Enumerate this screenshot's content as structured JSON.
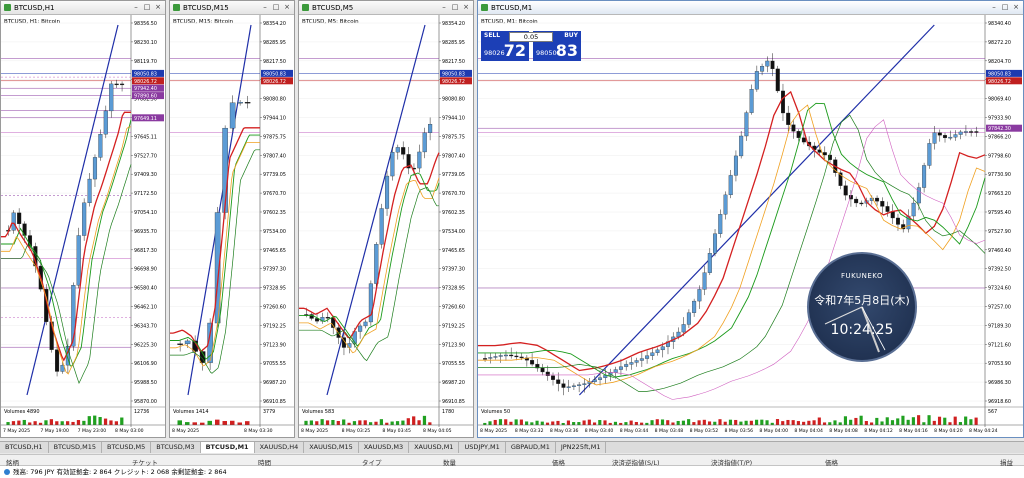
{
  "windows": [
    {
      "title": "BTCUSD,H1",
      "sub": "BTCUSD, H1: Bitcoin",
      "prices": [
        "98356.50",
        "98230.10",
        "98119.70",
        "97991.80",
        "97882.90",
        "97764.00",
        "97645.11",
        "97527.70",
        "97409.30",
        "97172.50",
        "97054.10",
        "96935.70",
        "96817.30",
        "96698.90",
        "96580.40",
        "96462.10",
        "96343.70",
        "96225.30",
        "96106.90",
        "95988.50",
        "95870.00"
      ],
      "labels": [
        "98050.83",
        "98026.72",
        "97942.40",
        "97890.60",
        "97649.11"
      ],
      "dates": [
        "7 May 2025",
        "7 May 19:00",
        "7 May 23:00",
        "8 May 03:00"
      ],
      "volume": "Volumes 4890",
      "vol_right": "12736"
    },
    {
      "title": "BTCUSD,M15",
      "sub": "BTCUSD, M15: Bitcoin",
      "prices": [
        "98354.20",
        "98285.95",
        "98217.50",
        "98149.15",
        "98080.80",
        "97944.10",
        "97875.75",
        "97807.40",
        "97739.05",
        "97670.70",
        "97602.35",
        "97534.00",
        "97465.65",
        "97397.30",
        "97328.95",
        "97260.60",
        "97192.25",
        "97123.90",
        "97055.55",
        "96987.20",
        "96910.85"
      ],
      "labels": [
        "98050.83",
        "98026.72"
      ],
      "dates": [
        "8 May 2025",
        "8 May 03:30"
      ],
      "volume": "Volumes 1414",
      "vol_right": "3779"
    },
    {
      "title": "BTCUSD,M5",
      "sub": "BTCUSD, M5: Bitcoin",
      "prices": [
        "98354.20",
        "98285.95",
        "98217.50",
        "98149.15",
        "98080.80",
        "97944.10",
        "97875.75",
        "97807.40",
        "97739.05",
        "97670.70",
        "97602.35",
        "97534.00",
        "97465.65",
        "97397.30",
        "97328.95",
        "97260.60",
        "97192.25",
        "97123.90",
        "97055.55",
        "96987.20",
        "96910.85"
      ],
      "labels": [
        "98050.83",
        "98026.72"
      ],
      "dates": [
        "8 May 2025",
        "8 May 03:25",
        "8 May 03:45",
        "8 May 04:05"
      ],
      "volume": "Volumes 583",
      "vol_right": "1780"
    },
    {
      "title": "BTCUSD,M1",
      "sub": "BTCUSD, M1: Bitcoin",
      "prices": [
        "98340.40",
        "98272.20",
        "98204.70",
        "98137.00",
        "98069.40",
        "97933.90",
        "97866.20",
        "97798.60",
        "97730.90",
        "97663.20",
        "97595.40",
        "97527.90",
        "97460.40",
        "97392.50",
        "97324.60",
        "97257.00",
        "97189.30",
        "97121.60",
        "97053.90",
        "96986.30",
        "96918.60"
      ],
      "labels": [
        "98050.83",
        "98026.72",
        "97842.30"
      ],
      "dates": [
        "8 May 2025",
        "8 May 03:32",
        "8 May 03:36",
        "8 May 03:40",
        "8 May 03:44",
        "8 May 03:48",
        "8 May 03:52",
        "8 May 03:56",
        "8 May 04:00",
        "8 May 04:04",
        "8 May 04:08",
        "8 May 04:12",
        "8 May 04:16",
        "8 May 04:20",
        "8 May 04:24"
      ],
      "volume": "Volumes 50",
      "vol_right": "567"
    }
  ],
  "trade": {
    "sell": "SELL",
    "buy": "BUY",
    "lot": "0.05",
    "sell_small": "98026",
    "sell_big": "72",
    "buy_small": "98050",
    "buy_big": "83"
  },
  "clock": {
    "brand": "FUKUNEKO",
    "date": "令和7年5月8日(木)",
    "time": "10:24:25"
  },
  "tabs": [
    "BTCUSD,H1",
    "BTCUSD,M15",
    "BTCUSD,M5",
    "BTCUSD,M3",
    "BTCUSD,M1",
    "XAUUSD,H4",
    "XAUUSD,M15",
    "XAUUSD,M3",
    "XAUUSD,M1",
    "USDJPY,M1",
    "GBPAUD,M1",
    "JPN225ft,M1"
  ],
  "active_tab": 4,
  "columns": [
    "銘柄",
    "チケット",
    "時間",
    "タイプ",
    "数量",
    "価格",
    "決済逆指値(S/L)",
    "決済指値(T/P)",
    "価格",
    "損益"
  ],
  "balance": "残高: 796 JPY 有効証拠金: 2 864 クレジット: 2 068 余剰証拠金: 2 864",
  "colors": {
    "bull": "#5b9bd5",
    "bear": "#111111",
    "ma_red": "#d42020",
    "ma_green": "#1a9a1a",
    "ma_orange": "#f0a020",
    "trend_blue": "#1f2fa8",
    "level_purple": "#8a3aa0"
  }
}
